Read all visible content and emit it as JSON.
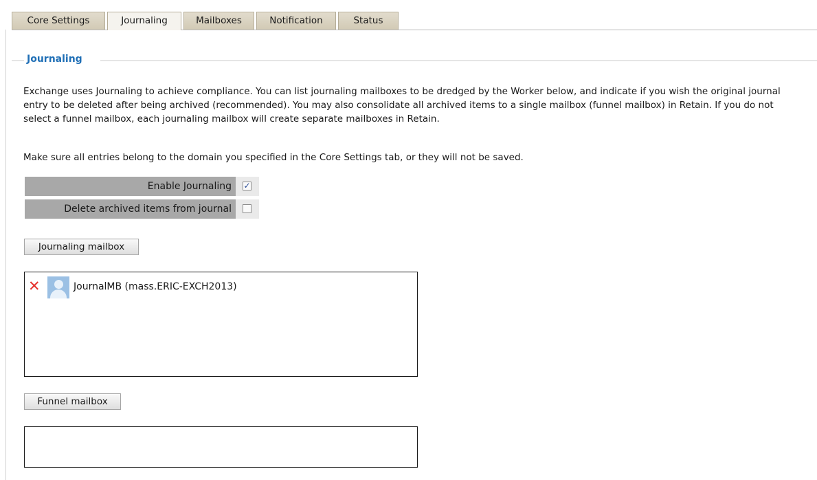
{
  "tabs": [
    {
      "label": "Core Settings"
    },
    {
      "label": "Journaling"
    },
    {
      "label": "Mailboxes"
    },
    {
      "label": "Notification"
    },
    {
      "label": "Status"
    }
  ],
  "active_tab": "Journaling",
  "section": {
    "title": "Journaling",
    "description": "Exchange uses Journaling to achieve compliance. You can list journaling mailboxes to be dredged by the Worker below, and indicate if you wish the original journal entry to be deleted after being archived (recommended). You may also consolidate all archived items to a single mailbox (funnel mailbox) in Retain. If you do not select a funnel mailbox, each journaling mailbox will create separate mailboxes in Retain.",
    "note": "Make sure all entries belong to the domain you specified in the Core Settings tab, or they will not be saved."
  },
  "options": {
    "enable_journaling": {
      "label": "Enable Journaling",
      "checked": true,
      "mark": "✓"
    },
    "delete_archived": {
      "label": "Delete archived items from journal",
      "checked": false,
      "mark": ""
    }
  },
  "journaling_mailbox": {
    "button_label": "Journaling mailbox",
    "entries": [
      {
        "name": "JournalMB (mass.ERIC-EXCH2013)",
        "remove_icon": "x-icon",
        "icon": "user-avatar-icon"
      }
    ]
  },
  "funnel_mailbox": {
    "button_label": "Funnel mailbox",
    "entries": []
  },
  "colors": {
    "legend": "#1f6fb6",
    "tab_bg": "#d6cfbc",
    "option_label_bg": "#a8a8a8",
    "remove_icon": "#e5322d"
  }
}
